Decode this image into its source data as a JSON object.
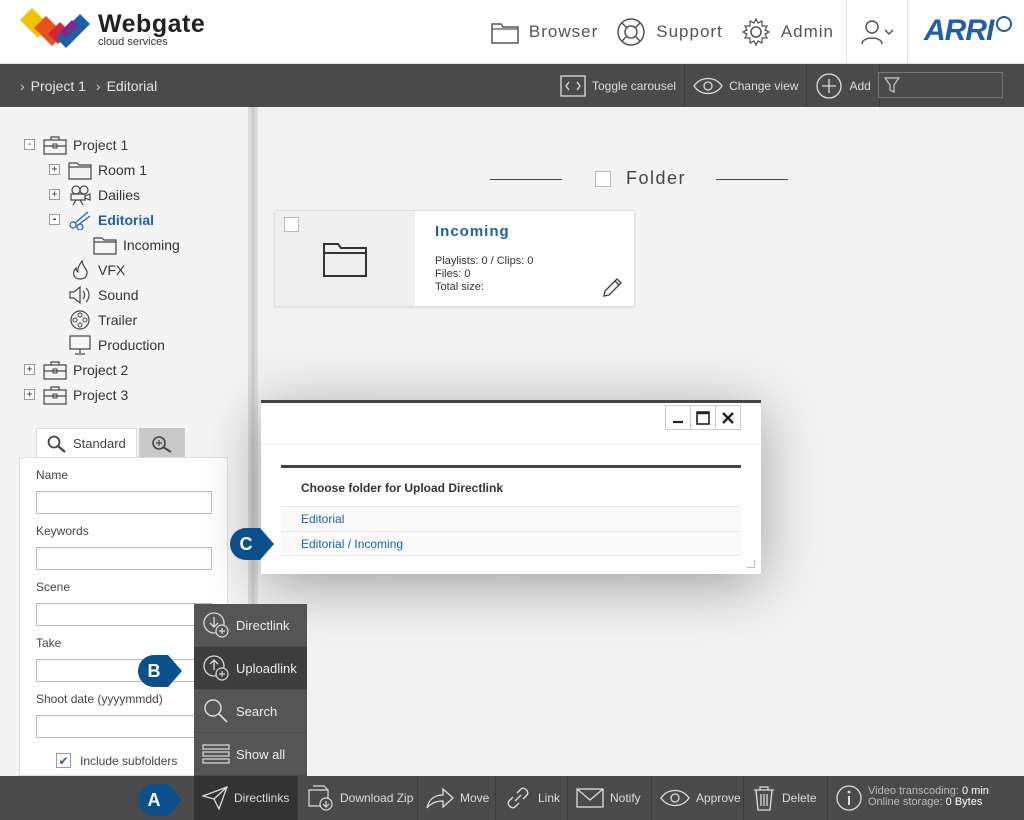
{
  "header": {
    "logo_title": "Webgate",
    "logo_sub": "cloud services",
    "nav": [
      {
        "label": "Browser",
        "icon": "folder-icon"
      },
      {
        "label": "Support",
        "icon": "lifebuoy-icon"
      },
      {
        "label": "Admin",
        "icon": "gear-icon"
      }
    ],
    "brand": "ARRI"
  },
  "breadcrumb": [
    "Project 1",
    "Editorial"
  ],
  "toolbar": {
    "toggle_carousel": "Toggle carousel",
    "change_view": "Change view",
    "add": "Add",
    "filter_value": ""
  },
  "tree": [
    {
      "label": "Project 1",
      "toggle": "-"
    },
    {
      "label": "Room 1",
      "toggle": "+"
    },
    {
      "label": "Dailies",
      "toggle": "+"
    },
    {
      "label": "Editorial",
      "toggle": "-"
    },
    {
      "label": "Incoming"
    },
    {
      "label": "VFX"
    },
    {
      "label": "Sound"
    },
    {
      "label": "Trailer"
    },
    {
      "label": "Production"
    },
    {
      "label": "Project 2",
      "toggle": "+"
    },
    {
      "label": "Project 3",
      "toggle": "+"
    }
  ],
  "search": {
    "tab_standard": "Standard",
    "fields": [
      "Name",
      "Keywords",
      "Scene",
      "Take",
      "Shoot date (yyyymmdd)"
    ],
    "include_subfolders": "Include subfolders"
  },
  "main": {
    "section_title": "Folder",
    "card": {
      "title": "Incoming",
      "playlists": "Playlists: 0 / Clips: 0",
      "files": "Files: 0",
      "total_size": "Total size:"
    }
  },
  "dialog": {
    "heading": "Choose folder for Upload Directlink",
    "rows": [
      "Editorial",
      "Editorial / Incoming"
    ]
  },
  "popmenu": [
    "Directlink",
    "Uploadlink",
    "Search",
    "Show all"
  ],
  "bottombar": {
    "items": [
      "Directlinks",
      "Download Zip",
      "Move",
      "Link",
      "Notify",
      "Approve",
      "Delete"
    ],
    "status_video_label": "Video transcoding:",
    "status_video_value": "0 min",
    "status_storage_label": "Online storage:",
    "status_storage_value": "0 Bytes"
  },
  "callouts": [
    "A",
    "B",
    "C"
  ],
  "colors": {
    "accent": "#1f5fa8",
    "callout": "#0b4f8c",
    "bar": "#4a4a4a"
  }
}
